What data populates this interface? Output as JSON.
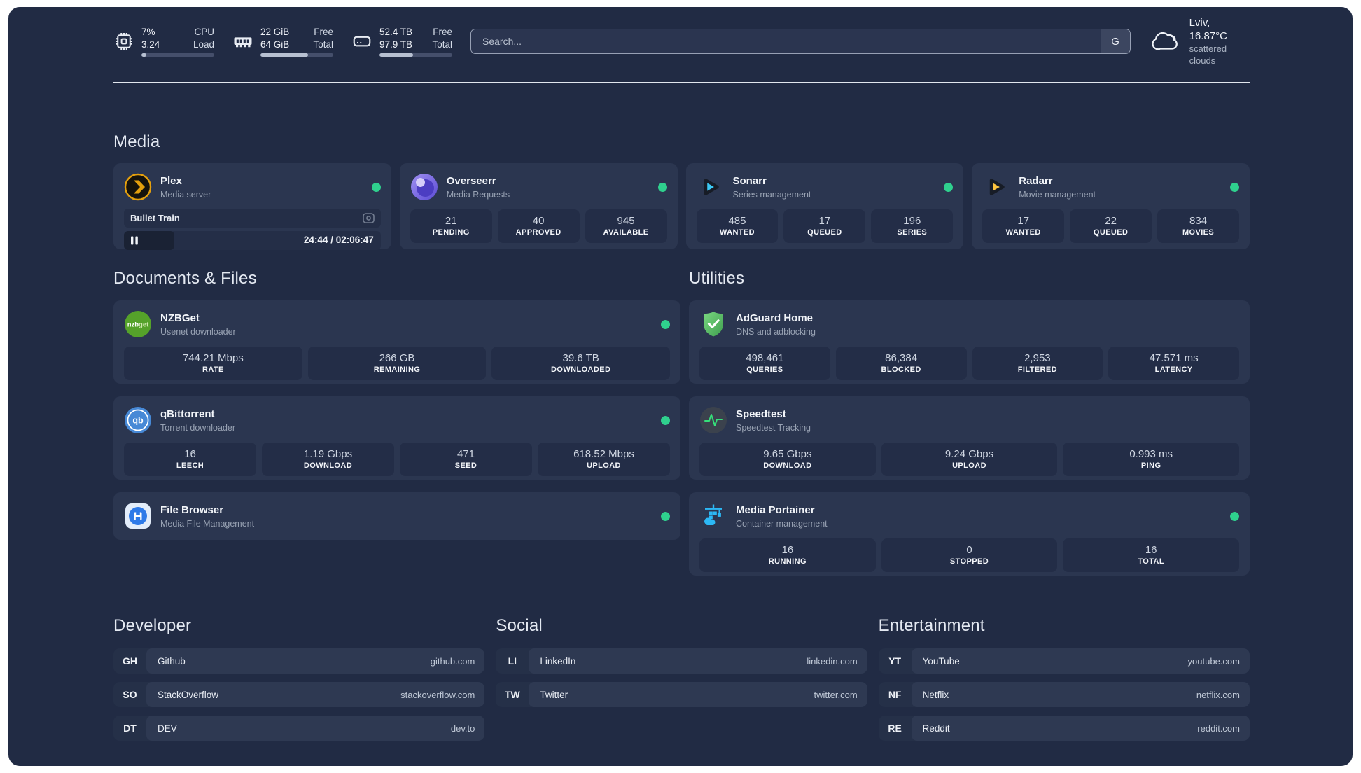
{
  "theme": {
    "background": "#212b44",
    "card": "#2b3650",
    "stat_box": "#232d47",
    "status_online": "#2fd08e",
    "divider": "#e2e7ef",
    "plex_accent": "#e5a00d"
  },
  "header": {
    "resources": [
      {
        "icon": "cpu-icon",
        "row1_value": "7%",
        "row1_label": "CPU",
        "row2_value": "3.24",
        "row2_label": "Load",
        "progress_pct": 7
      },
      {
        "icon": "memory-icon",
        "row1_value": "22 GiB",
        "row1_label": "Free",
        "row2_value": "64 GiB",
        "row2_label": "Total",
        "progress_pct": 65
      },
      {
        "icon": "disk-icon",
        "row1_value": "52.4 TB",
        "row1_label": "Free",
        "row2_value": "97.9 TB",
        "row2_label": "Total",
        "progress_pct": 46
      }
    ],
    "search": {
      "placeholder": "Search...",
      "provider_button": "G"
    },
    "weather": {
      "icon": "cloud-icon",
      "location_temp": "Lviv, 16.87°C",
      "condition": "scattered clouds"
    }
  },
  "sections": {
    "media": {
      "title": "Media",
      "services": [
        {
          "name": "Plex",
          "description": "Media server",
          "icon": "plex-icon",
          "status": "online",
          "now_playing": {
            "title": "Bullet Train",
            "time": "24:44 / 02:06:47",
            "progress_pct": 19.5
          }
        },
        {
          "name": "Overseerr",
          "description": "Media Requests",
          "icon": "overseerr-icon",
          "status": "online",
          "stats": [
            {
              "value": "21",
              "label": "PENDING"
            },
            {
              "value": "40",
              "label": "APPROVED"
            },
            {
              "value": "945",
              "label": "AVAILABLE"
            }
          ]
        },
        {
          "name": "Sonarr",
          "description": "Series management",
          "icon": "sonarr-icon",
          "status": "online",
          "stats": [
            {
              "value": "485",
              "label": "WANTED"
            },
            {
              "value": "17",
              "label": "QUEUED"
            },
            {
              "value": "196",
              "label": "SERIES"
            }
          ]
        },
        {
          "name": "Radarr",
          "description": "Movie management",
          "icon": "radarr-icon",
          "status": "online",
          "stats": [
            {
              "value": "17",
              "label": "WANTED"
            },
            {
              "value": "22",
              "label": "QUEUED"
            },
            {
              "value": "834",
              "label": "MOVIES"
            }
          ]
        }
      ]
    },
    "documents": {
      "title": "Documents & Files",
      "services": [
        {
          "name": "NZBGet",
          "description": "Usenet downloader",
          "icon": "nzbget-icon",
          "status": "online",
          "stats": [
            {
              "value": "744.21 Mbps",
              "label": "RATE"
            },
            {
              "value": "266 GB",
              "label": "REMAINING"
            },
            {
              "value": "39.6 TB",
              "label": "DOWNLOADED"
            }
          ]
        },
        {
          "name": "qBittorrent",
          "description": "Torrent downloader",
          "icon": "qbittorrent-icon",
          "status": "online",
          "stats": [
            {
              "value": "16",
              "label": "LEECH"
            },
            {
              "value": "1.19 Gbps",
              "label": "DOWNLOAD"
            },
            {
              "value": "471",
              "label": "SEED"
            },
            {
              "value": "618.52 Mbps",
              "label": "UPLOAD"
            }
          ]
        },
        {
          "name": "File Browser",
          "description": "Media File Management",
          "icon": "filebrowser-icon",
          "status": "online"
        }
      ]
    },
    "utilities": {
      "title": "Utilities",
      "services": [
        {
          "name": "AdGuard Home",
          "description": "DNS and adblocking",
          "icon": "adguard-icon",
          "stats": [
            {
              "value": "498,461",
              "label": "QUERIES"
            },
            {
              "value": "86,384",
              "label": "BLOCKED"
            },
            {
              "value": "2,953",
              "label": "FILTERED"
            },
            {
              "value": "47.571 ms",
              "label": "LATENCY"
            }
          ]
        },
        {
          "name": "Speedtest",
          "description": "Speedtest Tracking",
          "icon": "speedtest-icon",
          "stats": [
            {
              "value": "9.65 Gbps",
              "label": "DOWNLOAD"
            },
            {
              "value": "9.24 Gbps",
              "label": "UPLOAD"
            },
            {
              "value": "0.993 ms",
              "label": "PING"
            }
          ]
        },
        {
          "name": "Media Portainer",
          "description": "Container management",
          "icon": "portainer-icon",
          "status": "online",
          "stats": [
            {
              "value": "16",
              "label": "RUNNING"
            },
            {
              "value": "0",
              "label": "STOPPED"
            },
            {
              "value": "16",
              "label": "TOTAL"
            }
          ]
        }
      ]
    }
  },
  "bookmarks": [
    {
      "title": "Developer",
      "links": [
        {
          "abbr": "GH",
          "name": "Github",
          "domain": "github.com"
        },
        {
          "abbr": "SO",
          "name": "StackOverflow",
          "domain": "stackoverflow.com"
        },
        {
          "abbr": "DT",
          "name": "DEV",
          "domain": "dev.to"
        }
      ]
    },
    {
      "title": "Social",
      "links": [
        {
          "abbr": "LI",
          "name": "LinkedIn",
          "domain": "linkedin.com"
        },
        {
          "abbr": "TW",
          "name": "Twitter",
          "domain": "twitter.com"
        }
      ]
    },
    {
      "title": "Entertainment",
      "links": [
        {
          "abbr": "YT",
          "name": "YouTube",
          "domain": "youtube.com"
        },
        {
          "abbr": "NF",
          "name": "Netflix",
          "domain": "netflix.com"
        },
        {
          "abbr": "RE",
          "name": "Reddit",
          "domain": "reddit.com"
        }
      ]
    }
  ]
}
